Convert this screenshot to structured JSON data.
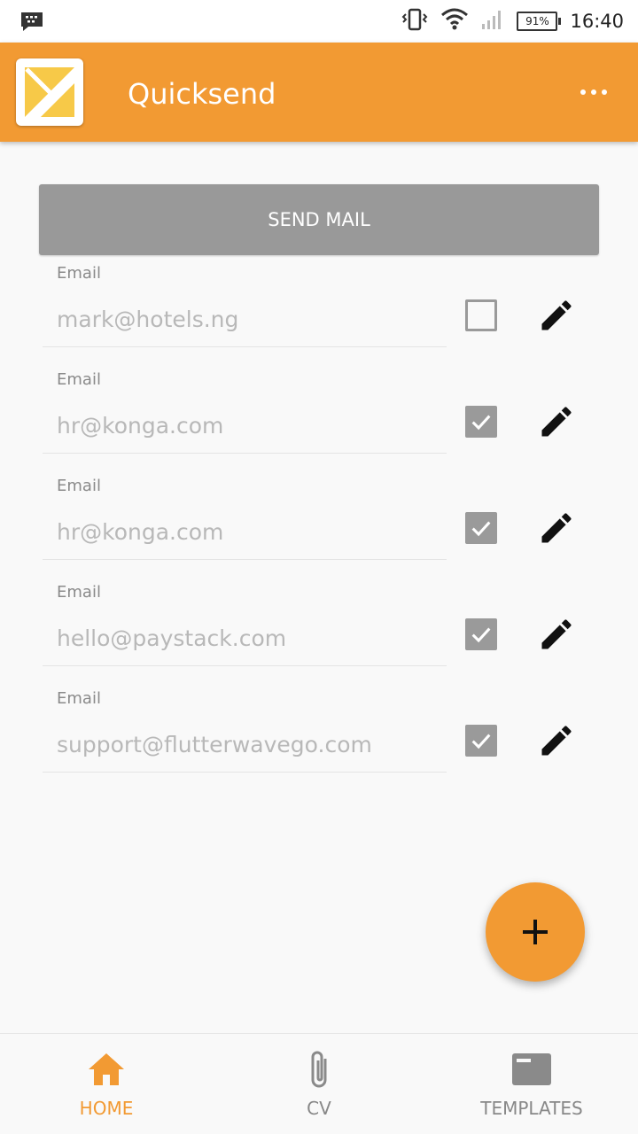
{
  "status_bar": {
    "battery": "91%",
    "time": "16:40"
  },
  "app_bar": {
    "title": "Quicksend",
    "logo_icon": "quicksend-logo-icon",
    "menu_icon": "more-horizontal-icon"
  },
  "send_button": {
    "label": "SEND MAIL"
  },
  "emails": [
    {
      "label": "Email",
      "value": "mark@hotels.ng",
      "checked": false
    },
    {
      "label": "Email",
      "value": "hr@konga.com",
      "checked": true
    },
    {
      "label": "Email",
      "value": "hr@konga.com",
      "checked": true
    },
    {
      "label": "Email",
      "value": "hello@paystack.com",
      "checked": true
    },
    {
      "label": "Email",
      "value": "support@flutterwavego.com",
      "checked": true
    }
  ],
  "fab": {
    "icon": "plus-icon"
  },
  "bottom_nav": {
    "items": [
      {
        "label": "HOME",
        "icon": "home-icon",
        "active": true
      },
      {
        "label": "CV",
        "icon": "paperclip-icon",
        "active": false
      },
      {
        "label": "TEMPLATES",
        "icon": "template-icon",
        "active": false
      }
    ]
  },
  "colors": {
    "primary": "#f29a33",
    "button_gray": "#999999",
    "checkbox_gray": "#9a9a9a"
  }
}
